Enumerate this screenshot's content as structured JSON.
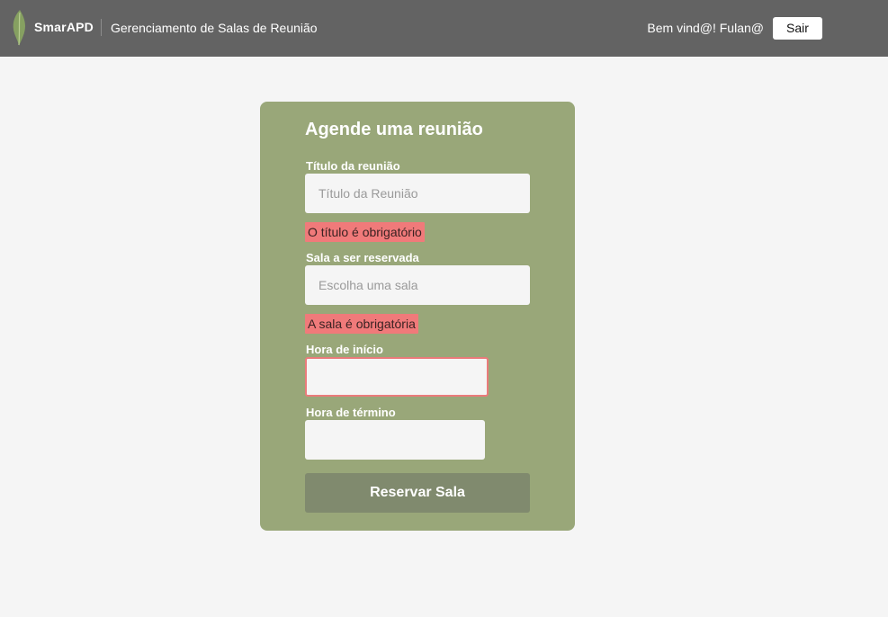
{
  "header": {
    "brand": "SmarAPD",
    "app_title": "Gerenciamento de Salas de Reunião",
    "welcome": "Bem vind@! Fulan@",
    "logout_label": "Sair"
  },
  "form": {
    "title": "Agende uma reunião",
    "meeting_title": {
      "label": "Título da reunião",
      "placeholder": "Título da Reunião",
      "error": "O título é obrigatório"
    },
    "room": {
      "label": "Sala a ser reservada",
      "placeholder": "Escolha uma sala",
      "error": "A sala é obrigatória"
    },
    "start_time": {
      "label": "Hora de início",
      "value": ""
    },
    "end_time": {
      "label": "Hora de término",
      "value": ""
    },
    "submit_label": "Reservar Sala"
  },
  "colors": {
    "header_bg": "#636363",
    "card_bg": "#99a779",
    "error_bg": "#f07a7a",
    "button_bg": "#808a6e",
    "page_bg": "#f5f5f5"
  }
}
